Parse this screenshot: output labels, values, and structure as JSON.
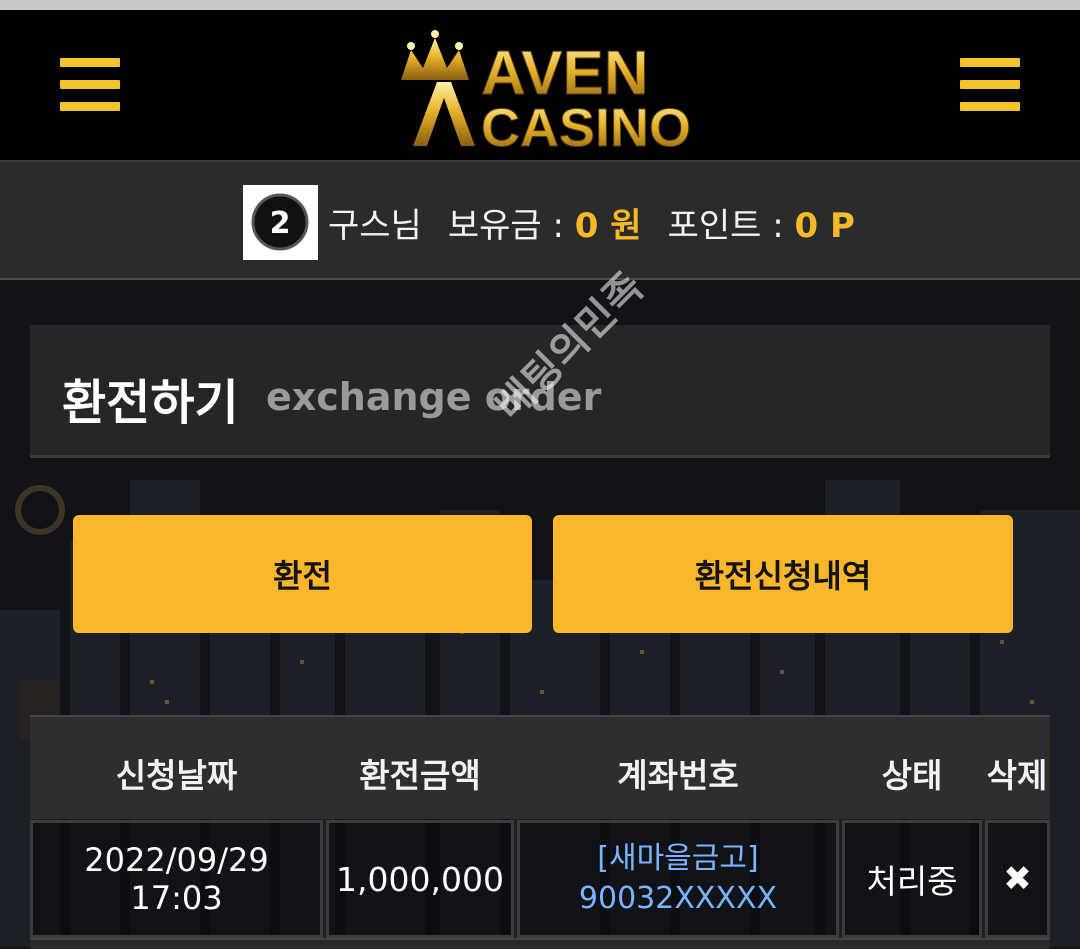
{
  "header": {
    "brand_top": "AVEN",
    "brand_bottom": "CASINO",
    "accent": "#f5c42c"
  },
  "user": {
    "avatar_level": "2",
    "name": "구스님",
    "balance_label": "보유금 :",
    "balance_value": "0 원",
    "points_label": "포인트 :",
    "points_value": "0 P"
  },
  "page": {
    "title_ko": "환전하기",
    "title_en": "exchange order",
    "watermark": "베팅의민족"
  },
  "buttons": {
    "exchange": "환전",
    "history": "환전신청내역",
    "color": "#fbb72c"
  },
  "table": {
    "headers": [
      "신청날짜",
      "환전금액",
      "계좌번호",
      "상태",
      "삭제"
    ],
    "rows": [
      {
        "date": "2022/09/29",
        "time": "17:03",
        "amount": "1,000,000",
        "bank": "[새마을금고]",
        "account": "90032XXXXX",
        "status": "처리중",
        "delete": "✖"
      }
    ]
  }
}
